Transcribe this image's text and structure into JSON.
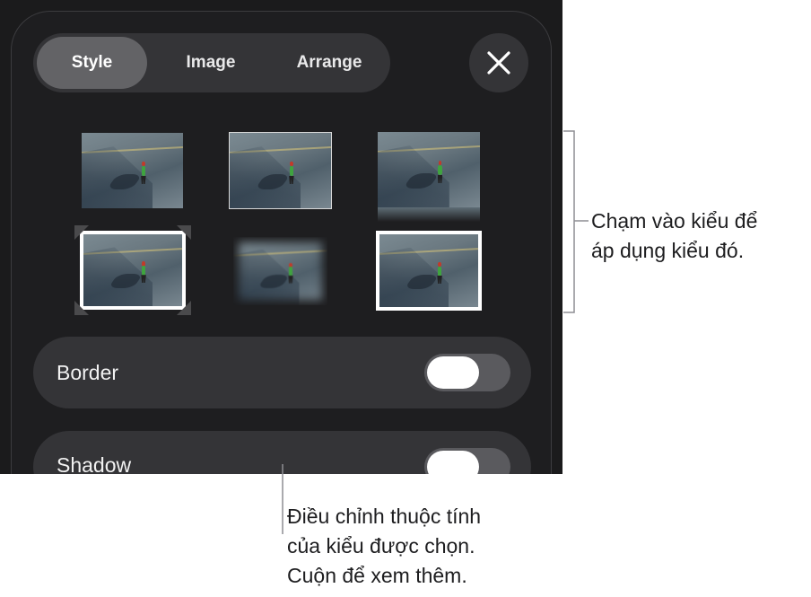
{
  "tabs": [
    {
      "label": "Style",
      "active": true
    },
    {
      "label": "Image",
      "active": false
    },
    {
      "label": "Arrange",
      "active": false
    }
  ],
  "close_icon": "close-x-icon",
  "styles": [
    {
      "name": "no-border"
    },
    {
      "name": "thin-border"
    },
    {
      "name": "reflection"
    },
    {
      "name": "corner-mount"
    },
    {
      "name": "soft-edge"
    },
    {
      "name": "white-frame"
    }
  ],
  "properties": [
    {
      "label": "Border",
      "on": false
    },
    {
      "label": "Shadow",
      "on": false
    }
  ],
  "callouts": {
    "styles_line1": "Chạm vào kiểu để",
    "styles_line2": "áp dụng kiểu đó.",
    "props_line1": "Điều chỉnh thuộc tính",
    "props_line2": "của kiểu được chọn.",
    "props_line3": "Cuộn để xem thêm."
  },
  "colors": {
    "panel_bg": "#1b1b1c",
    "control_bg": "#343437",
    "active_segment": "#636366",
    "toggle_off": "#5a5a5e"
  }
}
